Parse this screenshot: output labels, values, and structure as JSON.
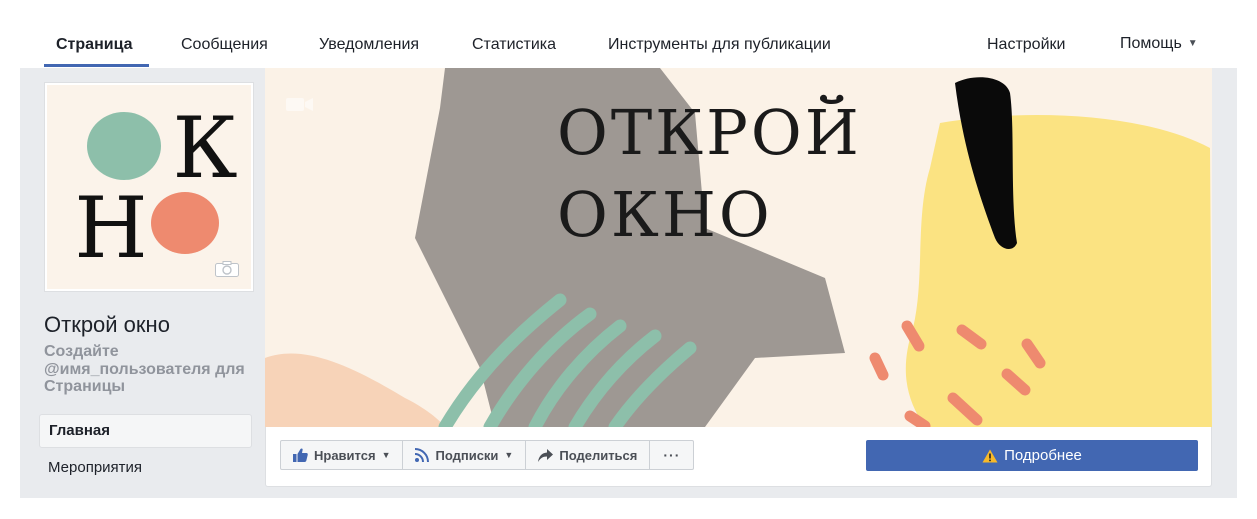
{
  "nav": {
    "page": "Страница",
    "messages": "Сообщения",
    "notifications": "Уведомления",
    "statistics": "Статистика",
    "publishing_tools": "Инструменты для публикации",
    "settings": "Настройки",
    "help": "Помощь"
  },
  "profile": {
    "logo_letters": [
      "О",
      "К",
      "Н",
      "О"
    ],
    "page_name": "Открой окно",
    "username_hint": "Создайте @имя_пользователя для Страницы"
  },
  "sidebar": {
    "items": [
      {
        "label": "Главная",
        "active": true
      },
      {
        "label": "Мероприятия",
        "active": false
      }
    ]
  },
  "cover": {
    "line1": "ОТКРОЙ",
    "line2": "ОКНО"
  },
  "actions": {
    "like": "Нравится",
    "follow": "Подписки",
    "share": "Поделиться",
    "more": "···",
    "learn_more": "Подробнее"
  },
  "colors": {
    "brand_blue": "#4267b2",
    "band_grey": "#e9ebee",
    "cover_bg": "#fbf2e7",
    "logo_green": "#8dbfaa",
    "logo_coral": "#ee8a6f",
    "cover_yellow": "#fbe382",
    "cover_grey": "#9e9893"
  }
}
